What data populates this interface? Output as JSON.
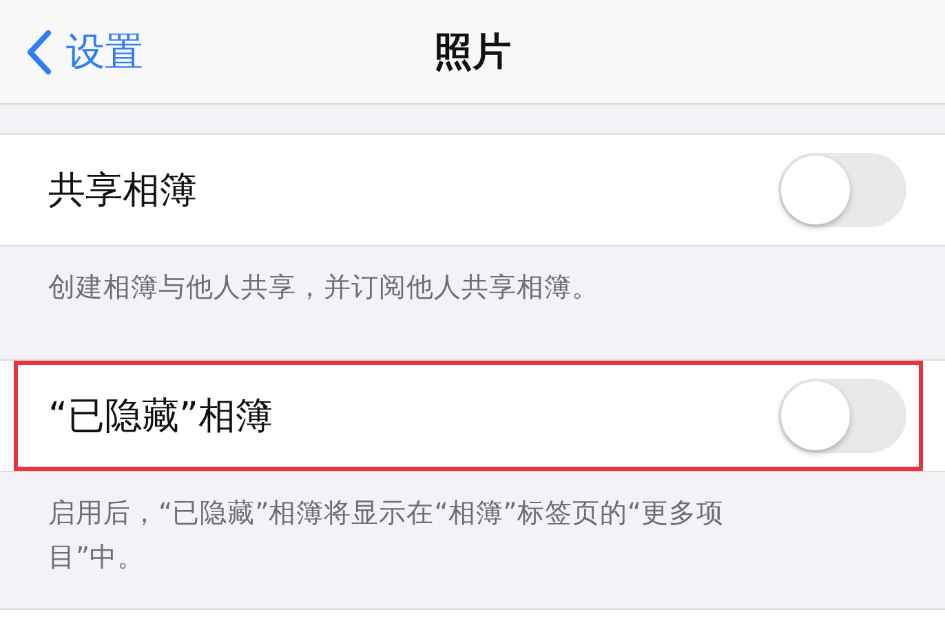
{
  "nav": {
    "back_label": "设置",
    "title": "照片"
  },
  "sections": [
    {
      "label": "共享相簿",
      "on": false,
      "highlighted": false,
      "footer": "创建相簿与他人共享，并订阅他人共享相簿。"
    },
    {
      "label": "“已隐藏”相簿",
      "on": false,
      "highlighted": true,
      "footer": "启用后，“已隐藏”相簿将显示在“相簿”标签页的“更多项目”中。"
    }
  ]
}
